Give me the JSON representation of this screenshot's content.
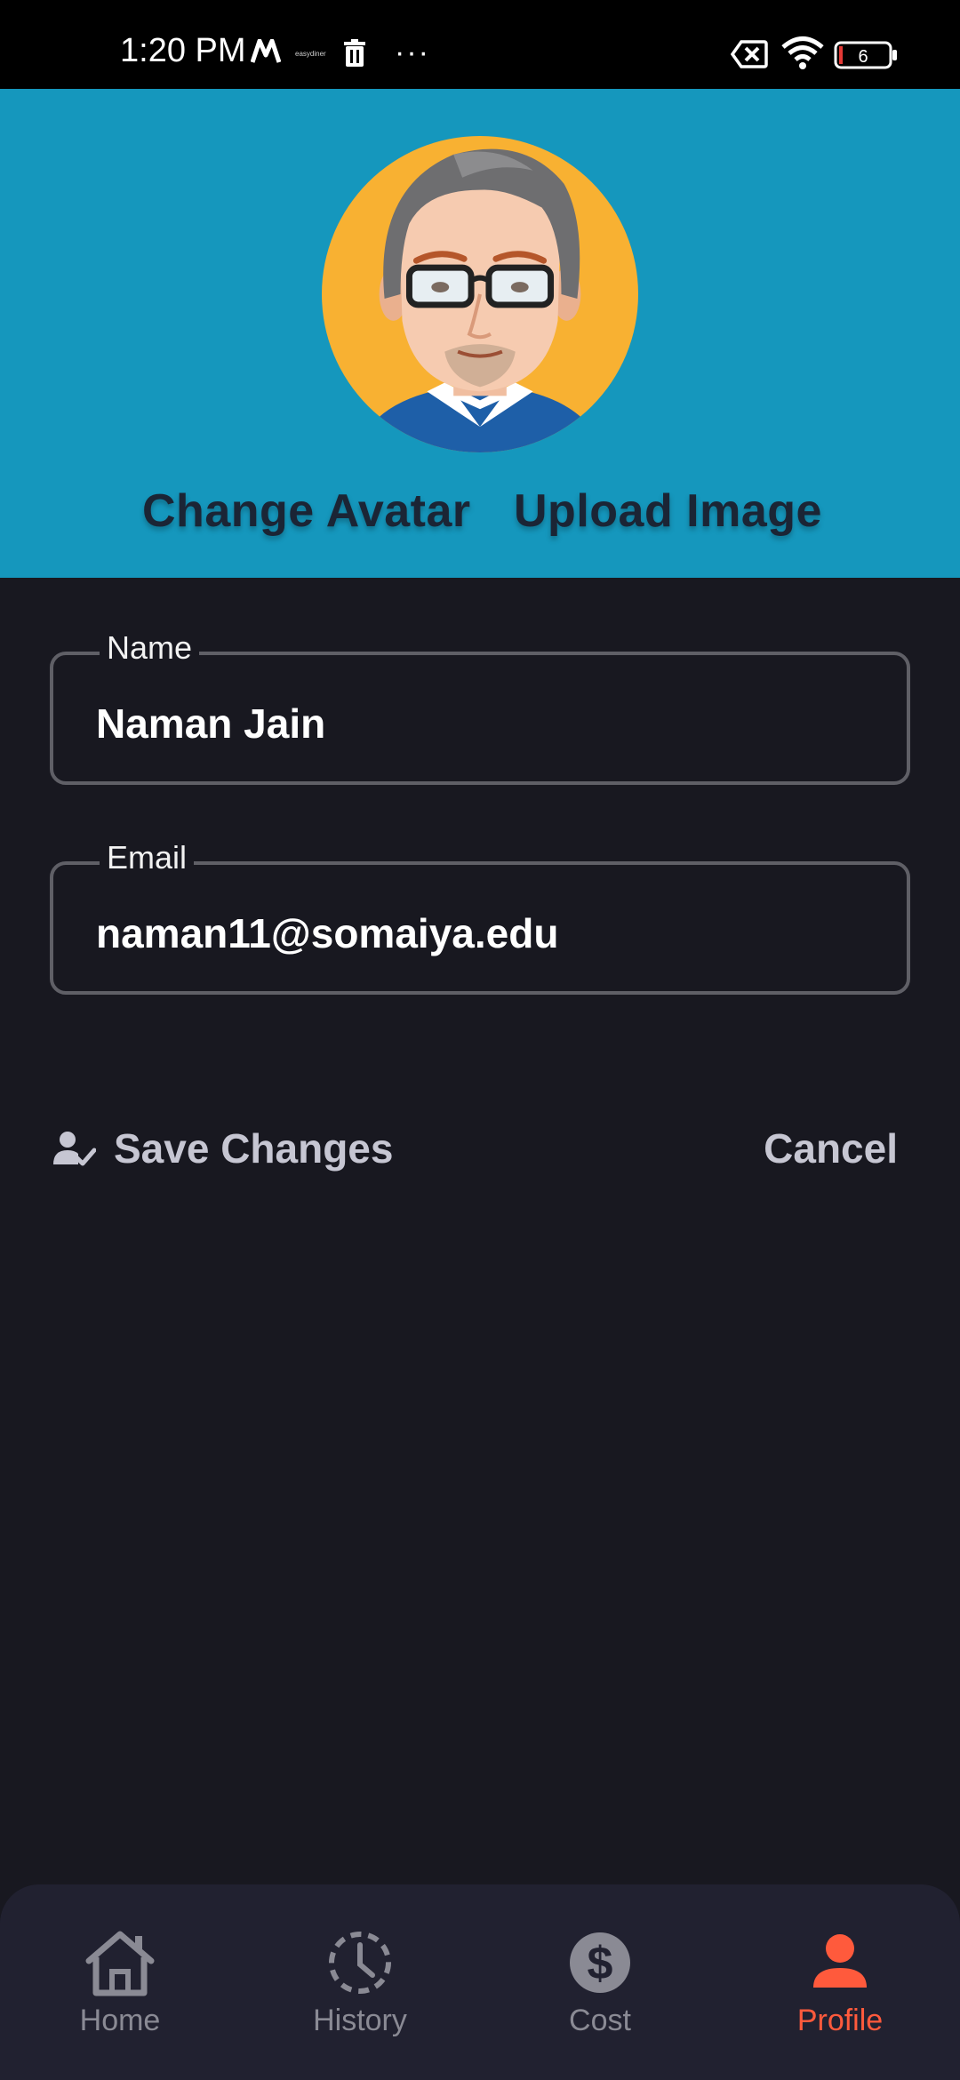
{
  "status_bar": {
    "time": "1:20 PM",
    "easy_text": "easydiner",
    "battery_level": "6",
    "icons": [
      "m-app-icon",
      "trash-icon",
      "more-dots-icon",
      "no-sim-icon",
      "wifi-icon",
      "battery-icon"
    ]
  },
  "header": {
    "change_avatar_label": "Change Avatar",
    "upload_image_label": "Upload Image",
    "background_color": "#1597bd"
  },
  "form": {
    "name_label": "Name",
    "name_value": "Naman Jain",
    "email_label": "Email",
    "email_value": "naman11@somaiya.edu"
  },
  "actions": {
    "save_label": "Save Changes",
    "cancel_label": "Cancel"
  },
  "bottom_nav": {
    "items": [
      {
        "label": "Home",
        "icon": "home-icon",
        "active": false
      },
      {
        "label": "History",
        "icon": "history-icon",
        "active": false
      },
      {
        "label": "Cost",
        "icon": "dollar-icon",
        "active": false
      },
      {
        "label": "Profile",
        "icon": "person-icon",
        "active": true
      }
    ],
    "active_color": "#ff5a3c",
    "inactive_color": "#8a8a94"
  }
}
